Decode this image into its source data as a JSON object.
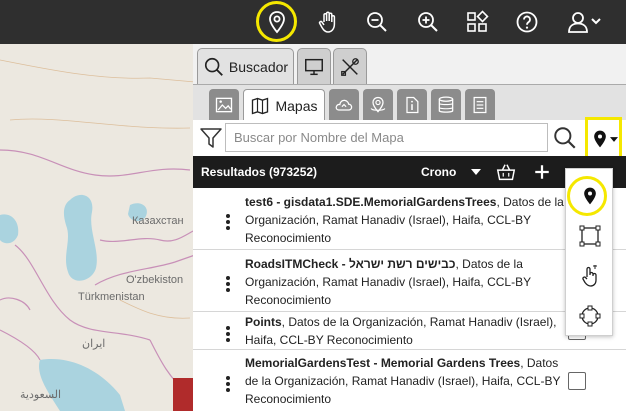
{
  "map": {
    "labels": [
      "Казахстан",
      "O'zbekiston",
      "Türkmenistan",
      "ایران",
      "السعودية"
    ]
  },
  "toolbar": {
    "buttons": [
      {
        "icon": "map-pin-icon",
        "highlighted": true
      },
      {
        "icon": "hand-pan-icon"
      },
      {
        "icon": "zoom-out-icon"
      },
      {
        "icon": "zoom-in-icon"
      },
      {
        "icon": "layers-grid-icon"
      },
      {
        "icon": "help-icon"
      },
      {
        "icon": "user-menu-icon"
      }
    ]
  },
  "panel": {
    "main_tabs": [
      {
        "label": "Buscador",
        "icon": "search-icon",
        "active": true
      },
      {
        "label": "",
        "icon": "monitor-icon"
      },
      {
        "label": "",
        "icon": "tools-icon"
      }
    ],
    "sub_tabs": [
      {
        "label": "",
        "icon": "image-icon"
      },
      {
        "label": "Mapas",
        "icon": "map-icon",
        "active": true
      },
      {
        "label": "",
        "icon": "cloud-upload-icon"
      },
      {
        "label": "",
        "icon": "geo-service-icon"
      },
      {
        "label": "",
        "icon": "document-info-icon"
      },
      {
        "label": "",
        "icon": "database-icon"
      },
      {
        "label": "",
        "icon": "list-icon"
      }
    ],
    "search": {
      "placeholder": "Buscar por Nombre del Mapa",
      "value": ""
    },
    "results": {
      "title": "Resultados (973252)",
      "sort_label": "Crono"
    },
    "items": [
      {
        "title": "test6 - gisdata1.SDE.MemorialGardensTrees",
        "desc": ", Datos de la Organización, Ramat Hanadiv (Israel), Haifa, CCL-BY Reconocimiento"
      },
      {
        "title": "RoadsITMCheck - כבישים רשת ישראל",
        "desc": ", Datos de la Organización, Ramat Hanadiv (Israel), Haifa, CCL-BY Reconocimiento"
      },
      {
        "title": "Points",
        "desc": ", Datos de la Organización, Ramat Hanadiv (Israel), Haifa, CCL-BY Reconocimiento"
      },
      {
        "title": "MemorialGardensTest - Memorial Gardens Trees",
        "desc": ", Datos de la Organización, Ramat Hanadiv (Israel), Haifa, CCL-BY Reconocimiento"
      }
    ]
  },
  "dropdown": {
    "items": [
      {
        "icon": "map-pin-icon",
        "highlighted": true
      },
      {
        "icon": "rectangle-select-icon"
      },
      {
        "icon": "hand-touch-icon"
      },
      {
        "icon": "polygon-select-icon"
      }
    ]
  },
  "colors": {
    "highlight": "#f5e800",
    "toolbar": "#2f2f2f",
    "header": "#1c1c1c"
  }
}
